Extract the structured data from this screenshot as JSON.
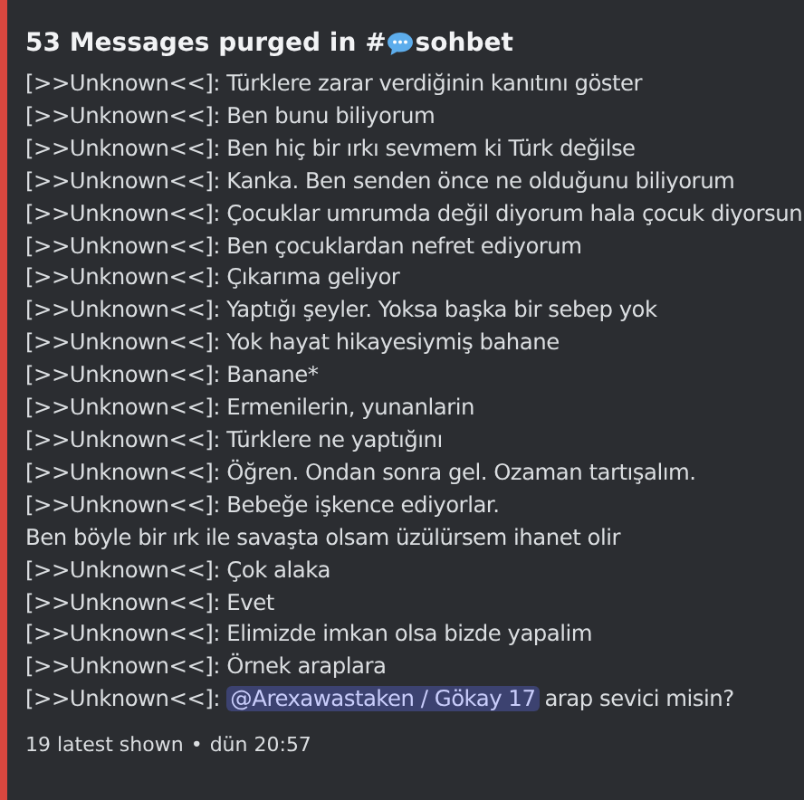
{
  "embed": {
    "title": {
      "text": "53 Messages purged in #",
      "channel": "sohbet"
    },
    "lines": [
      {
        "kind": "plain",
        "text": "[>>Unknown<<]: Türklere zarar verdiğinin kanıtını göster"
      },
      {
        "kind": "plain",
        "text": "[>>Unknown<<]: Ben bunu biliyorum"
      },
      {
        "kind": "plain",
        "text": "[>>Unknown<<]: Ben hiç bir ırkı sevmem ki Türk değilse"
      },
      {
        "kind": "plain",
        "text": "[>>Unknown<<]: Kanka. Ben senden önce ne olduğunu biliyorum"
      },
      {
        "kind": "plain",
        "text": "[>>Unknown<<]: Çocuklar umrumda değil diyorum hala çocuk diyorsun"
      },
      {
        "kind": "plain",
        "text": "[>>Unknown<<]: Ben çocuklardan nefret ediyorum"
      },
      {
        "kind": "plain",
        "text": "[>>Unknown<<]: Çıkarıma geliyor"
      },
      {
        "kind": "plain",
        "text": "[>>Unknown<<]: Yaptığı şeyler. Yoksa başka bir sebep yok"
      },
      {
        "kind": "plain",
        "text": "[>>Unknown<<]: Yok hayat hikayesiymiş bahane"
      },
      {
        "kind": "plain",
        "text": "[>>Unknown<<]: Banane*"
      },
      {
        "kind": "plain",
        "text": "[>>Unknown<<]: Ermenilerin, yunanlarin"
      },
      {
        "kind": "plain",
        "text": "[>>Unknown<<]: Türklere ne yaptığını"
      },
      {
        "kind": "plain",
        "text": "[>>Unknown<<]: Öğren. Ondan sonra gel. Ozaman tartışalım."
      },
      {
        "kind": "plain",
        "text": "[>>Unknown<<]: Bebeğe işkence ediyorlar."
      },
      {
        "kind": "plain",
        "text": "Ben böyle bir ırk ile savaşta olsam üzülürsem ihanet olir"
      },
      {
        "kind": "plain",
        "text": "[>>Unknown<<]: Çok alaka"
      },
      {
        "kind": "plain",
        "text": "[>>Unknown<<]: Evet"
      },
      {
        "kind": "plain",
        "text": "[>>Unknown<<]: Elimizde imkan olsa bizde yapalim"
      },
      {
        "kind": "plain",
        "text": "[>>Unknown<<]: Örnek araplara"
      },
      {
        "kind": "mention",
        "text": "[>>Unknown<<]: ",
        "mention": "@Arexawastaken / Gökay 17",
        "after": "arap sevici misin?"
      }
    ],
    "footer": {
      "count": "19 latest shown",
      "separator": "•",
      "time": "dün 20:57"
    }
  }
}
